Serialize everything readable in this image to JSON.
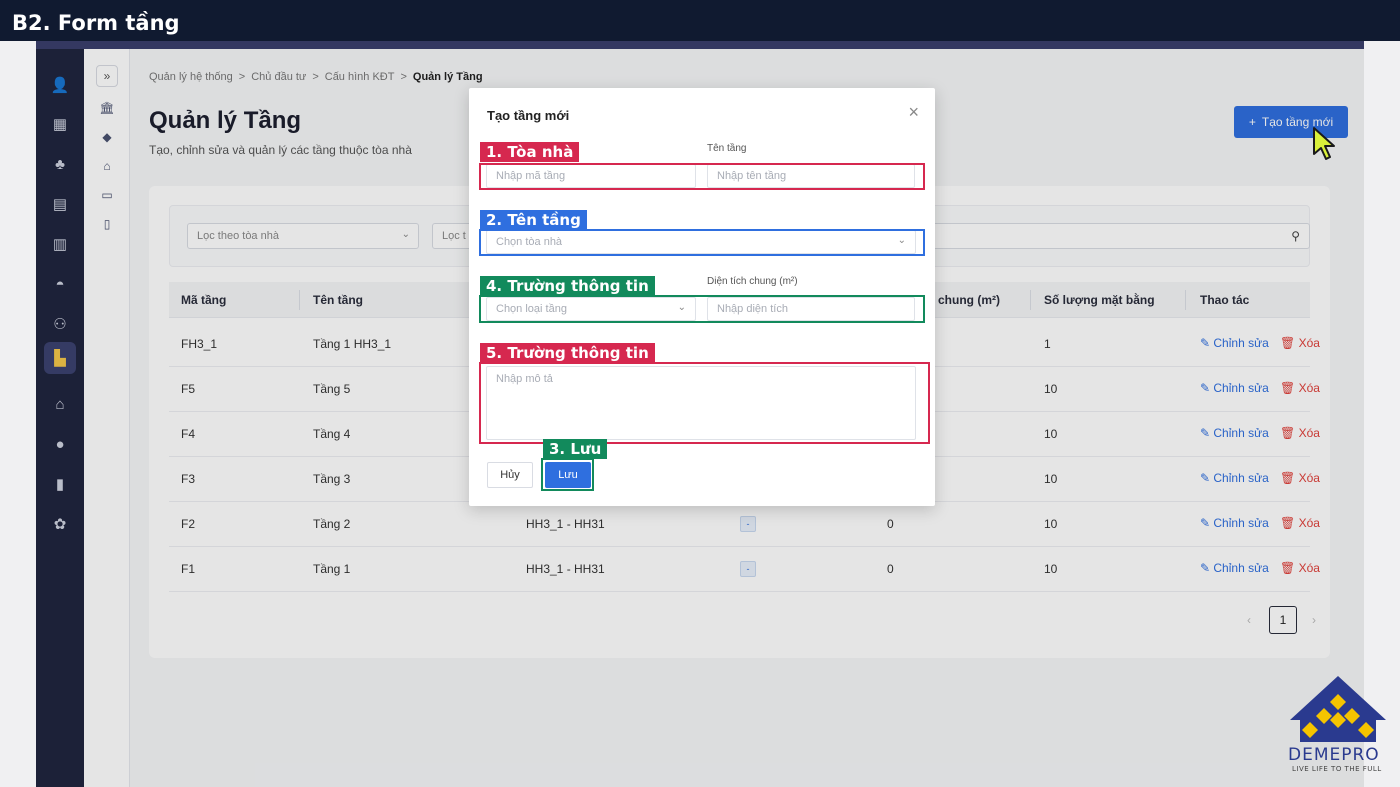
{
  "banner": {
    "title": "B2. Form tầng"
  },
  "breadcrumb": {
    "items": [
      "Quản lý hệ thống",
      "Chủ đầu tư",
      "Cấu hình KĐT"
    ],
    "current": "Quản lý Tầng",
    "separator": ">"
  },
  "page": {
    "title": "Quản lý Tầng",
    "subtitle": "Tạo, chỉnh sửa và quản lý các tầng thuộc tòa nhà",
    "create_label": "Tạo tầng mới",
    "create_icon": "+"
  },
  "filters": {
    "building_placeholder": "Lọc theo tòa nhà",
    "floor_placeholder": "Lọc t"
  },
  "table": {
    "columns": [
      "Mã tầng",
      "Tên tầng",
      "chung (m²)",
      "Số lượng mặt bằng",
      "Thao tác"
    ],
    "rows": [
      {
        "code": "FH3_1",
        "name": "Tầng 1 HH3_1",
        "building": "",
        "tag": "",
        "area": "",
        "count": "1"
      },
      {
        "code": "F5",
        "name": "Tầng 5",
        "building": "",
        "tag": "",
        "area": "",
        "count": "10"
      },
      {
        "code": "F4",
        "name": "Tầng 4",
        "building": "",
        "tag": "",
        "area": "",
        "count": "10"
      },
      {
        "code": "F3",
        "name": "Tầng 3",
        "building": "",
        "tag": "",
        "area": "",
        "count": "10"
      },
      {
        "code": "F2",
        "name": "Tầng 2",
        "building": "HH3_1 - HH31",
        "tag": "-",
        "area": "0",
        "count": "10"
      },
      {
        "code": "F1",
        "name": "Tầng 1",
        "building": "HH3_1 - HH31",
        "tag": "-",
        "area": "0",
        "count": "10"
      }
    ],
    "edit_label": "Chỉnh sửa",
    "delete_label": "Xóa"
  },
  "pagination": {
    "current": "1",
    "prev": "‹",
    "next": "›"
  },
  "modal": {
    "title": "Tạo tầng mới",
    "close": "×",
    "floor_name_label": "Tên tầng",
    "code_placeholder": "Nhập mã tầng",
    "name_placeholder": "Nhập tên tầng",
    "building_placeholder": "Chọn tòa nhà",
    "area_label": "Diện tích chung (m²)",
    "type_placeholder": "Chọn loại tầng",
    "area_placeholder": "Nhập diện tích",
    "desc_placeholder": "Nhập mô tả",
    "cancel_label": "Hủy",
    "save_label": "Lưu"
  },
  "annotations": {
    "a1": "1. Tòa nhà",
    "a2": "2. Tên tầng",
    "a4": "4. Trường thông tin",
    "a5": "5. Trường thông tin",
    "a3": "3. Lưu"
  },
  "brand": {
    "name": "DEMEPRO",
    "tagline": "LIVE LIFE TO THE FULL"
  },
  "icons": {
    "rail": [
      "user-icon",
      "building-icon",
      "network-icon",
      "calculator-icon",
      "briefcase-icon",
      "car-icon",
      "users-icon",
      "floor-icon",
      "store-icon",
      "person-icon",
      "chart-icon",
      "gear-icon"
    ],
    "sub": [
      "bank-icon",
      "tag-icon",
      "shop-icon",
      "box-icon",
      "door-icon"
    ]
  },
  "colors": {
    "accent": "#2f6fdf",
    "danger": "#e0403a",
    "annotation_red": "#d6284f",
    "annotation_blue": "#2f6fdf",
    "annotation_green": "#128a5c",
    "sidebar": "#20253f"
  }
}
